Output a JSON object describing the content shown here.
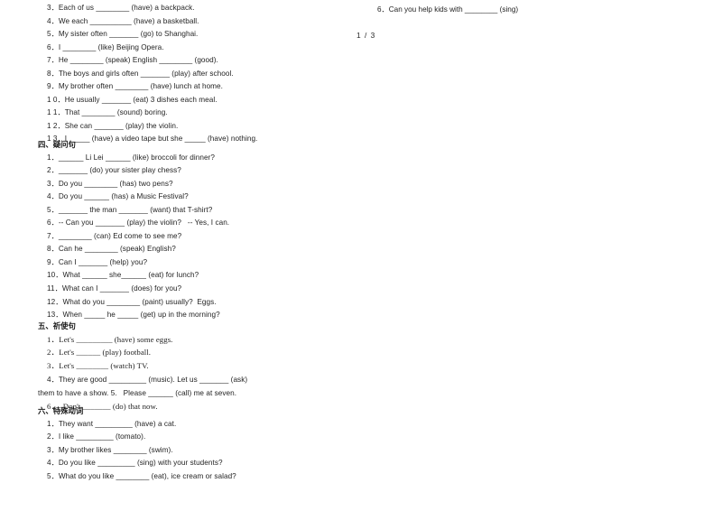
{
  "document": {
    "page_indicator": "1 / 3",
    "left_column": {
      "section_fill_blanks_continued": {
        "items": [
          "3．Each of us ________ (have) a backpack.",
          "4．We each __________ (have) a basketball.",
          "5．My sister often _______ (go) to Shanghai.",
          "6．I ________ (like) Beijing Opera.",
          "7．He ________ (speak) English ________ (good).",
          "8．The boys and girls often _______ (play) after school.",
          "9．My brother often ________ (have) lunch at home.",
          "1 0．He usually _______ (eat) 3 dishes each meal.",
          "1 1．That ________ (sound) boring.",
          "1 2．She can _______ (play) the violin.",
          "1 3．I _____ (have) a video tape but she _____ (have) nothing."
        ]
      },
      "section_four": {
        "heading": "四、疑问句",
        "items": [
          "1．______ Li Lei ______ (like) broccoli for dinner?",
          "2．_______ (do) your sister play chess?",
          "3．Do you ________ (has) two pens?",
          "4．Do you ______ (has) a Music Festival?",
          "5．_______ the man _______ (want) that T-shirt?",
          "6．-- Can you _______ (play) the violin?   -- Yes, I can.",
          "7．________ (can) Ed come to see me?",
          "8．Can he ________ (speak) English?",
          "9．Can I _______ (help) you?",
          "10．What ______ she______ (eat) for lunch?",
          "11．What can I _______ (does) for you?",
          "12．What do you ________ (paint) usually?  Eggs.",
          "13．When _____ he _____ (get) up in the morning?"
        ]
      },
      "section_five": {
        "heading": "五、祈使句",
        "items": [
          "1．Let's _________ (have) some eggs.",
          "2．Let's ______ (play) football.",
          "3．Let's ________ (watch) TV.",
          "4．They are good _________ (music). Let us _______ (ask)",
          "them to have a show. 5.   Please ______ (call) me at seven.",
          "6．  Don't _______ (do) that now."
        ]
      },
      "section_six": {
        "heading": "六、特殊动词",
        "items": [
          "1．They want _________ (have) a cat.",
          "2．I like _________ (tomato).",
          "3．My brother likes ________ (swim).",
          "4．Do you like _________ (sing) with your students?",
          "5．What do you like ________ (eat), ice cream or salad?"
        ]
      }
    },
    "right_column": {
      "item": "6．Can you help kids with ________ (sing)"
    }
  }
}
